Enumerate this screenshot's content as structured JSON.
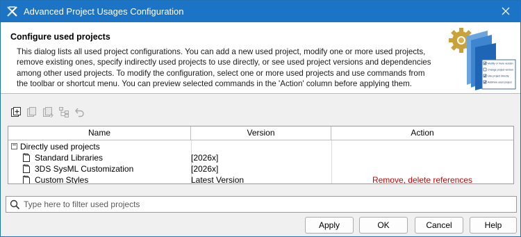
{
  "window": {
    "title": "Advanced Project Usages Configuration"
  },
  "header": {
    "title": "Configure used projects",
    "description": "This dialog lists all used project configurations. You can add a new used project, modify one or more used projects, remove existing ones, specify indirectly used projects to use directly, or see used project versions and dependencies among other used projects. To modify the configuration, select one or more used projects and use commands from the toolbar or shortcut menu. You can preview selected commands in the 'Action' column before applying them.",
    "graphic_checklist": [
      "Modify or mere version",
      "Change project version",
      "Use project directly",
      "Add/new used project"
    ]
  },
  "toolbar": {
    "buttons": [
      "add-project-icon",
      "copy-icon",
      "paste-icon",
      "hierarchy-icon",
      "undo-icon"
    ]
  },
  "table": {
    "columns": [
      "Name",
      "Version",
      "Action"
    ],
    "group": {
      "label": "Directly used projects",
      "toggle": "−"
    },
    "rows": [
      {
        "name": "Standard Libraries",
        "version": "[2026x]",
        "action": ""
      },
      {
        "name": "3DS SysML Customization",
        "version": "[2026x]",
        "action": ""
      },
      {
        "name": "Custom Styles",
        "version": "Latest Version",
        "action": "Remove, delete references"
      }
    ],
    "action_color": "#d00000"
  },
  "filter": {
    "placeholder": "Type here to filter used projects",
    "value": ""
  },
  "buttons": {
    "apply": "Apply",
    "ok": "OK",
    "cancel": "Cancel",
    "help": "Help"
  },
  "colors": {
    "titlebar": "#1b74c6",
    "accent": "#1b74c6"
  }
}
